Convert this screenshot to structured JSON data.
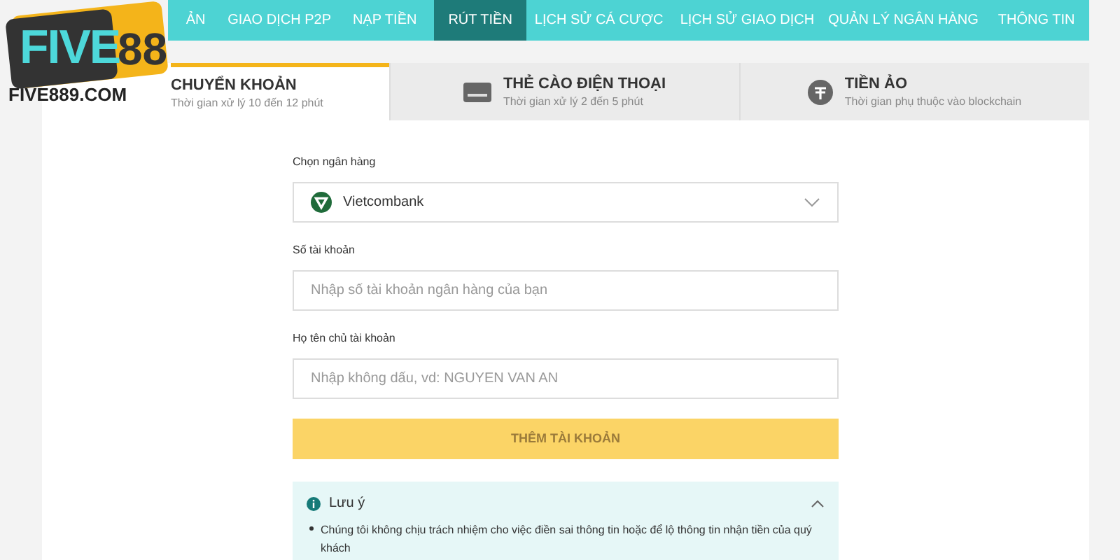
{
  "logo": {
    "word": "FIVE",
    "number": "88",
    "domain": "FIVE889.COM"
  },
  "nav": [
    {
      "label": "ẢN",
      "selected": false
    },
    {
      "label": "GIAO DỊCH P2P",
      "selected": false
    },
    {
      "label": "NẠP TIỀN",
      "selected": false
    },
    {
      "label": "RÚT TIỀN",
      "selected": true
    },
    {
      "label": "LỊCH SỬ CÁ CƯỢC",
      "selected": false
    },
    {
      "label": "LỊCH SỬ GIAO DỊCH",
      "selected": false
    },
    {
      "label": "QUẢN LÝ NGÂN HÀNG",
      "selected": false
    },
    {
      "label": "THÔNG TIN",
      "selected": false
    }
  ],
  "methods": [
    {
      "kind": "bank",
      "title": "CHUYỂN KHOẢN",
      "subtitle": "Thời gian xử lý 10 đến 12 phút",
      "selected": true
    },
    {
      "kind": "card",
      "title": "THẺ CÀO ĐIỆN THOẠI",
      "subtitle": "Thời gian xử lý 2 đến 5 phút",
      "selected": false
    },
    {
      "kind": "crypto",
      "title": "TIỀN ẢO",
      "subtitle": "Thời gian phụ thuộc vào blockchain",
      "selected": false
    }
  ],
  "form": {
    "bank_label": "Chọn ngân hàng",
    "bank_value": "Vietcombank",
    "account_label": "Số tài khoản",
    "account_placeholder": "Nhập số tài khoản ngân hàng của bạn",
    "name_label": "Họ tên chủ tài khoản",
    "name_placeholder": "Nhập không dấu, vd: NGUYEN VAN AN",
    "submit": "THÊM TÀI KHOẢN"
  },
  "note": {
    "title": "Lưu ý",
    "expanded": true,
    "items": [
      "Chúng tôi không chịu trách nhiệm cho việc điền sai thông tin hoặc để lộ thông tin nhận tiền của quý khách"
    ]
  }
}
